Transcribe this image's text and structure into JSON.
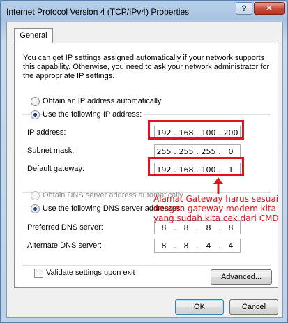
{
  "window": {
    "title": "Internet Protocol Version 4 (TCP/IPv4) Properties",
    "help_label": "?",
    "close_label": "✕"
  },
  "tabs": [
    {
      "label": "General"
    }
  ],
  "intro": "You can get IP settings assigned automatically if your network supports this capability. Otherwise, you need to ask your network administrator for the appropriate IP settings.",
  "ip_mode": {
    "auto_label": "Obtain an IP address automatically",
    "manual_label": "Use the following IP address:",
    "selected": "manual"
  },
  "ip_fields": {
    "ip_label": "IP address:",
    "ip_value": [
      "192",
      "168",
      "100",
      "200"
    ],
    "subnet_label": "Subnet mask:",
    "subnet_value": [
      "255",
      "255",
      "255",
      "0"
    ],
    "gateway_label": "Default gateway:",
    "gateway_value": [
      "192",
      "168",
      "100",
      "1"
    ]
  },
  "dns_mode": {
    "auto_label": "Obtain DNS server address automatically",
    "manual_label": "Use the following DNS server addresses:",
    "selected": "manual"
  },
  "dns_fields": {
    "preferred_label": "Preferred DNS server:",
    "preferred_value": [
      "8",
      "8",
      "8",
      "8"
    ],
    "alternate_label": "Alternate DNS server:",
    "alternate_value": [
      "8",
      "8",
      "4",
      "4"
    ]
  },
  "validate_label": "Validate settings upon exit",
  "validate_checked": false,
  "buttons": {
    "advanced": "Advanced...",
    "ok": "OK",
    "cancel": "Cancel"
  },
  "annotation": {
    "text": "Alamat Gateway harus sesuai dengan gateway modem kita yang sudah kita cek dari CMD",
    "color": "#e0141b"
  }
}
